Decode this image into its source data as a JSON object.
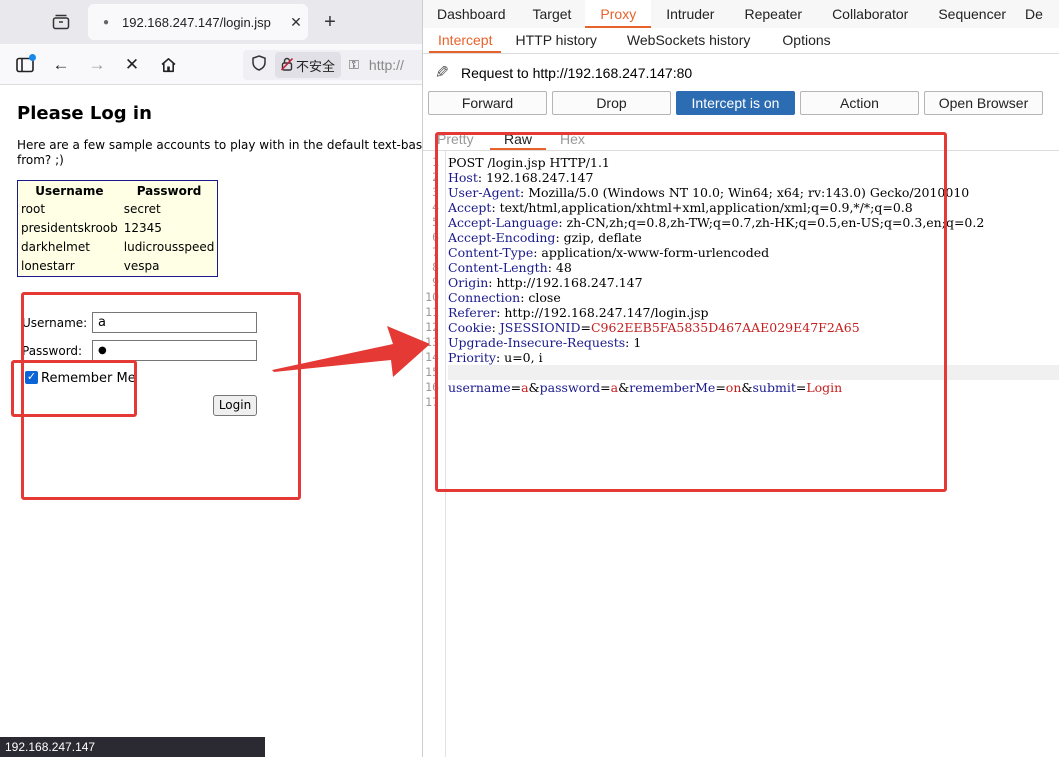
{
  "browser": {
    "tab": {
      "title": "192.168.247.147/login.jsp"
    },
    "addressbar": {
      "insecure_label": "不安全",
      "url_partial": "http://"
    },
    "page": {
      "title": "Please Log in",
      "intro": "Here are a few sample accounts to play with in the default text-bas",
      "intro_line2": "from? ;)",
      "accounts": {
        "headers": [
          "Username",
          "Password"
        ],
        "rows": [
          [
            "root",
            "secret"
          ],
          [
            "presidentskroob",
            "12345"
          ],
          [
            "darkhelmet",
            "ludicrousspeed"
          ],
          [
            "lonestarr",
            "vespa"
          ]
        ]
      },
      "form": {
        "username_label": "Username:",
        "username_value": "a",
        "password_label": "Password:",
        "password_value": "●",
        "remember_label": "Remember Me",
        "remember_checked": true,
        "login_label": "Login"
      }
    },
    "statusbar": "192.168.247.147"
  },
  "burp": {
    "main_tabs": [
      "Dashboard",
      "Target",
      "Proxy",
      "Intruder",
      "Repeater",
      "Collaborator",
      "Sequencer",
      "De"
    ],
    "main_tab_active": "Proxy",
    "sub_tabs": [
      "Intercept",
      "HTTP history",
      "WebSockets history",
      "Options"
    ],
    "sub_tab_active": "Intercept",
    "request_label": "Request to http://192.168.247.147:80",
    "buttons": {
      "forward": "Forward",
      "drop": "Drop",
      "intercept": "Intercept is on",
      "action": "Action",
      "open_browser": "Open Browser"
    },
    "view_tabs": [
      "Pretty",
      "Raw",
      "Hex"
    ],
    "view_tab_active": "Raw",
    "line_numbers": [
      "1",
      "2",
      "3",
      "4",
      "5",
      "6",
      "7",
      "8",
      "9",
      "10",
      "11",
      "12",
      "13",
      "14",
      "15",
      "16",
      "17"
    ],
    "request": {
      "request_line": "POST /login.jsp HTTP/1.1",
      "headers": [
        {
          "name": "Host",
          "value": "192.168.247.147"
        },
        {
          "name": "User-Agent",
          "value": "Mozilla/5.0 (Windows NT 10.0; Win64; x64; rv:143.0) Gecko/2010010"
        },
        {
          "name": "Accept",
          "value": "text/html,application/xhtml+xml,application/xml;q=0.9,*/*;q=0.8"
        },
        {
          "name": "Accept-Language",
          "value": "zh-CN,zh;q=0.8,zh-TW;q=0.7,zh-HK;q=0.5,en-US;q=0.3,en;q=0.2"
        },
        {
          "name": "Accept-Encoding",
          "value": "gzip, deflate"
        },
        {
          "name": "Content-Type",
          "value": "application/x-www-form-urlencoded"
        },
        {
          "name": "Content-Length",
          "value": "48"
        },
        {
          "name": "Origin",
          "value": "http://192.168.247.147"
        },
        {
          "name": "Connection",
          "value": "close"
        },
        {
          "name": "Referer",
          "value": "http://192.168.247.147/login.jsp"
        }
      ],
      "cookie": {
        "name": "Cookie",
        "cookie_name": "JSESSIONID",
        "cookie_value": "C962EEB5FA5835D467AAE029E47F2A65"
      },
      "headers_after": [
        {
          "name": "Upgrade-Insecure-Requests",
          "value": "1"
        },
        {
          "name": "Priority",
          "value": "u=0, i"
        }
      ],
      "body_params": [
        {
          "name": "username",
          "value": "a"
        },
        {
          "name": "password",
          "value": "a"
        },
        {
          "name": "rememberMe",
          "value": "on"
        },
        {
          "name": "submit",
          "value": "Login"
        }
      ]
    }
  },
  "colors": {
    "annotation_red": "#e53935",
    "burp_accent": "#e8622c",
    "intercept_on_bg": "#2c6cb2",
    "header_name": "#1a1a8c",
    "param_value": "#c41e1e"
  }
}
